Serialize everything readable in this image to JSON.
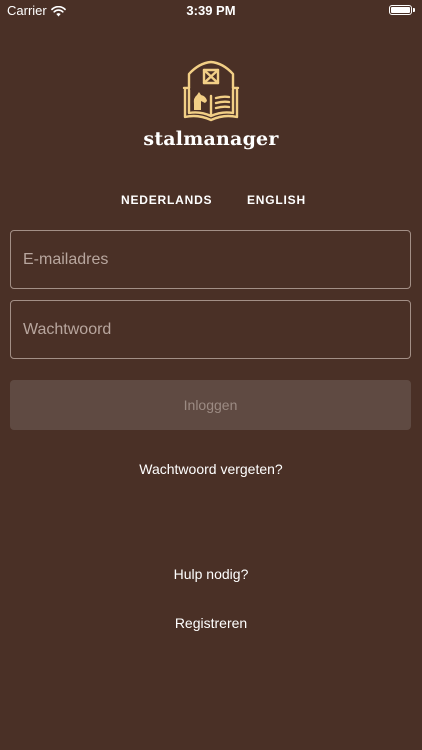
{
  "status_bar": {
    "carrier": "Carrier",
    "time": "3:39 PM",
    "wifi_icon": "wifi-icon",
    "battery_icon": "battery-icon"
  },
  "brand": {
    "logo_icon": "barn-book-horse-icon",
    "name": "stalmanager",
    "accent_color": "#f2cf86"
  },
  "languages": [
    "NEDERLANDS",
    "ENGLISH"
  ],
  "form": {
    "email_placeholder": "E-mailadres",
    "email_value": "",
    "password_placeholder": "Wachtwoord",
    "password_value": "",
    "login_label": "Inloggen",
    "forgot_label": "Wachtwoord vergeten?"
  },
  "footer": {
    "help_label": "Hulp nodig?",
    "register_label": "Registreren"
  },
  "colors": {
    "background": "#4a3026",
    "button_disabled": "#5f4a42",
    "field_border": "#a38f86"
  }
}
